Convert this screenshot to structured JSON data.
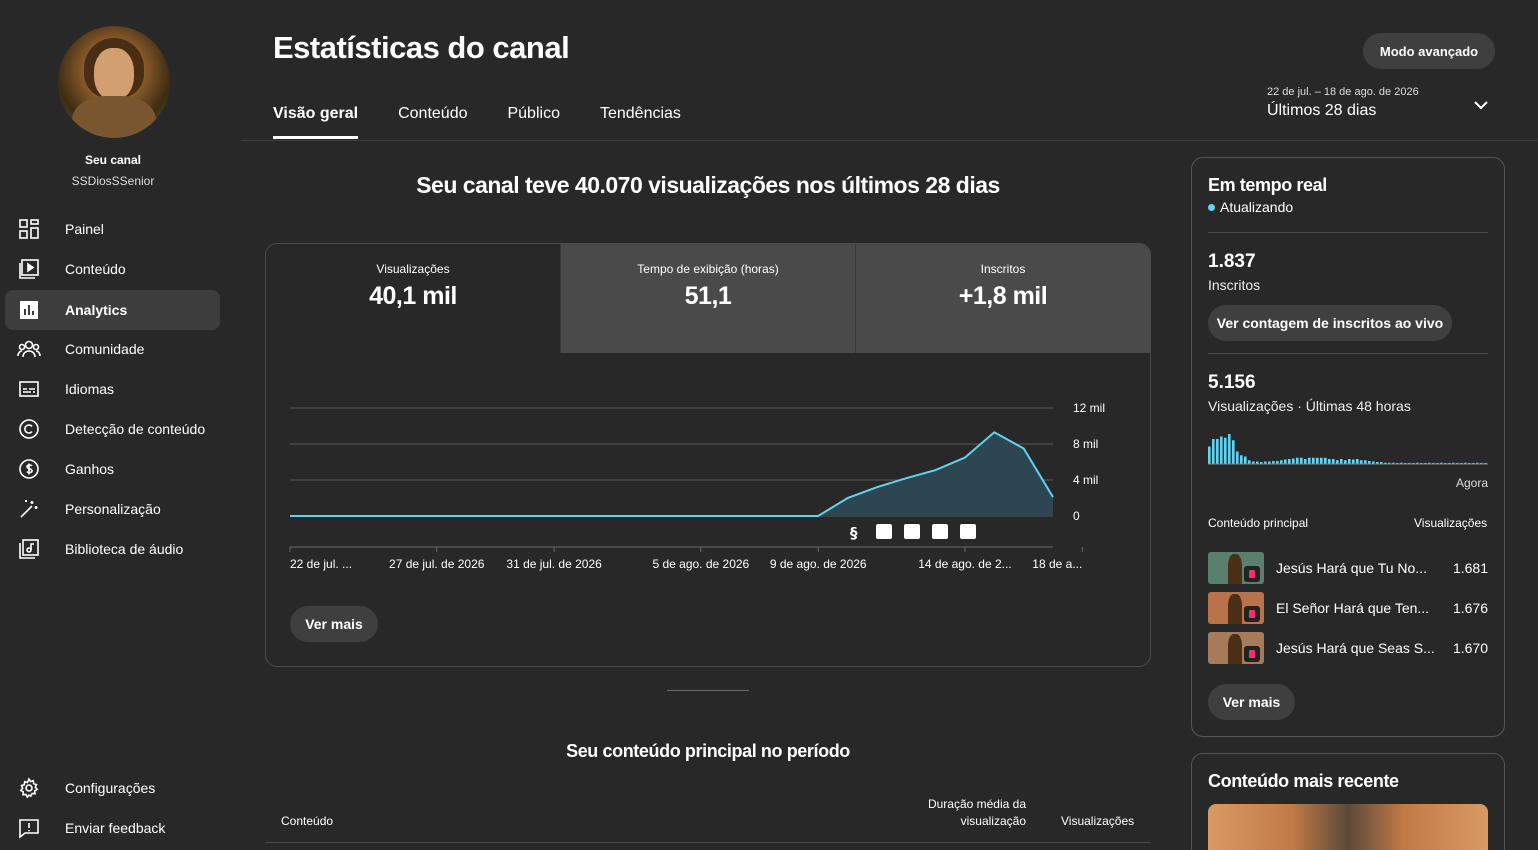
{
  "channel": {
    "label": "Seu canal",
    "name": "SSDiosSSenior"
  },
  "sidebar": {
    "items": [
      {
        "label": "Painel",
        "icon": "dashboard-icon"
      },
      {
        "label": "Conteúdo",
        "icon": "content-icon"
      },
      {
        "label": "Analytics",
        "icon": "analytics-icon",
        "active": true
      },
      {
        "label": "Comunidade",
        "icon": "community-icon"
      },
      {
        "label": "Idiomas",
        "icon": "subtitles-icon"
      },
      {
        "label": "Detecção de conteúdo",
        "icon": "copyright-icon"
      },
      {
        "label": "Ganhos",
        "icon": "dollar-icon"
      },
      {
        "label": "Personalização",
        "icon": "magic-wand-icon"
      },
      {
        "label": "Biblioteca de áudio",
        "icon": "audio-library-icon"
      }
    ],
    "bottom": [
      {
        "label": "Configurações",
        "icon": "gear-icon"
      },
      {
        "label": "Enviar feedback",
        "icon": "feedback-icon"
      }
    ]
  },
  "header": {
    "title": "Estatísticas do canal",
    "advanced_button": "Modo avançado",
    "tabs": [
      "Visão geral",
      "Conteúdo",
      "Público",
      "Tendências"
    ],
    "date_range": "22 de jul. – 18 de ago. de 2026",
    "period": "Últimos 28 dias"
  },
  "main": {
    "headline": "Seu canal teve 40.070 visualizações nos últimos 28 dias",
    "metrics": [
      {
        "title": "Visualizações",
        "value": "40,1 mil"
      },
      {
        "title": "Tempo de exibição (horas)",
        "value": "51,1"
      },
      {
        "title": "Inscritos",
        "value": "+1,8 mil"
      }
    ],
    "ver_mais": "Ver mais",
    "top_content_title": "Seu conteúdo principal no período",
    "table_headers": {
      "content": "Conteúdo",
      "avg_duration": "Duração média da visualização",
      "views": "Visualizações"
    }
  },
  "chart_data": {
    "type": "area",
    "y_ticks": [
      "12 mil",
      "8 mil",
      "4 mil",
      "0"
    ],
    "ylim": [
      0,
      12000
    ],
    "x_labels": [
      "22 de jul. ...",
      "27 de jul. de 2026",
      "31 de jul. de 2026",
      "5 de ago. de 2026",
      "9 de ago. de 2026",
      "14 de ago. de 2...",
      "18 de a..."
    ],
    "x_label_days": [
      0,
      5,
      9,
      14,
      18,
      23,
      27
    ],
    "values": [
      0,
      0,
      0,
      0,
      0,
      0,
      0,
      0,
      0,
      0,
      0,
      0,
      0,
      0,
      0,
      0,
      0,
      0,
      0,
      2000,
      3200,
      4200,
      5100,
      6500,
      9300,
      7500,
      2100
    ],
    "line_color": "#5fd4f2",
    "fill_color": "#2e4651",
    "grid": true
  },
  "realtime": {
    "title": "Em tempo real",
    "status": "Atualizando",
    "subs_value": "1.837",
    "subs_label": "Inscritos",
    "subs_button": "Ver contagem de inscritos ao vivo",
    "views_value": "5.156",
    "views_label": "Visualizações · Últimas 48 horas",
    "now_label": "Agora",
    "col_content": "Conteúdo principal",
    "col_views": "Visualizações",
    "bars": [
      0.7,
      1.0,
      1.0,
      1.1,
      1.05,
      1.2,
      0.95,
      0.5,
      0.35,
      0.3,
      0.15,
      0.1,
      0.1,
      0.08,
      0.1,
      0.1,
      0.12,
      0.12,
      0.15,
      0.18,
      0.2,
      0.22,
      0.25,
      0.25,
      0.2,
      0.25,
      0.25,
      0.25,
      0.25,
      0.25,
      0.2,
      0.2,
      0.15,
      0.2,
      0.15,
      0.2,
      0.18,
      0.2,
      0.15,
      0.15,
      0.12,
      0.1,
      0.08,
      0.08,
      0.05,
      0.05,
      0.05,
      0.04,
      0.05,
      0.04,
      0.04,
      0.03,
      0.05,
      0.04,
      0.04,
      0.05,
      0.04,
      0.03,
      0.05,
      0.04,
      0.04,
      0.05,
      0.04,
      0.03,
      0.05,
      0.04,
      0.04,
      0.05,
      0.04,
      0.04
    ],
    "bar_color": "#5fd4f2",
    "top": [
      {
        "title": "Jesús Hará que Tu No...",
        "views": "1.681",
        "color": "#5b7f6e"
      },
      {
        "title": "El Señor Hará que Ten...",
        "views": "1.676",
        "color": "#b9734a"
      },
      {
        "title": "Jesús Hará que Seas S...",
        "views": "1.670",
        "color": "#a57b5a"
      }
    ],
    "ver_mais": "Ver mais"
  },
  "recent": {
    "title": "Conteúdo mais recente"
  }
}
